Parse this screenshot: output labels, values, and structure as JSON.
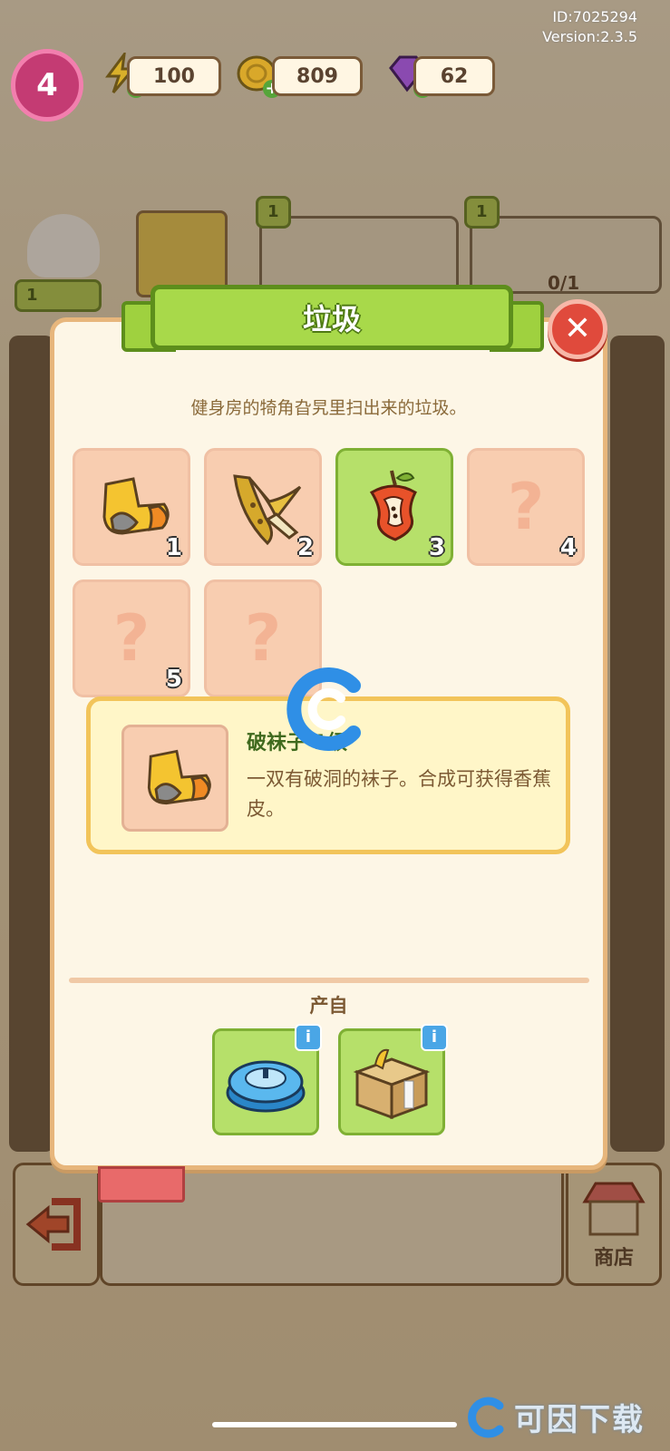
{
  "header": {
    "id_text": "ID:7025294",
    "version_text": "Version:2.3.5",
    "level": "4",
    "resources": [
      {
        "icon": "lightning-icon",
        "value": "100"
      },
      {
        "icon": "coin-icon",
        "value": "809"
      },
      {
        "icon": "gem-icon",
        "value": "62"
      }
    ]
  },
  "background": {
    "cards": [
      {
        "tag": "1"
      },
      {
        "tag": "1"
      },
      {
        "counter": "0/1"
      }
    ],
    "worker_tag": "1",
    "shop_label": "商店"
  },
  "dialog": {
    "title": "垃圾",
    "description": "健身房的犄角旮旯里扫出来的垃圾。",
    "slots": [
      {
        "num": "1",
        "icon": "sock-icon",
        "unlocked": true
      },
      {
        "num": "2",
        "icon": "banana-peel-icon",
        "unlocked": true
      },
      {
        "num": "3",
        "icon": "apple-core-icon",
        "unlocked": true,
        "selected": true
      },
      {
        "num": "4",
        "icon": "question-icon",
        "unlocked": false
      },
      {
        "num": "5",
        "icon": "question-icon",
        "unlocked": false
      },
      {
        "num": "",
        "icon": "question-icon",
        "unlocked": false
      }
    ],
    "info": {
      "title": "破袜子 1级",
      "text": "一双有破洞的袜子。合成可获得香蕉皮。"
    },
    "produce_label": "产自",
    "sources": [
      {
        "icon": "robot-vacuum-icon"
      },
      {
        "icon": "cardboard-box-icon"
      }
    ]
  },
  "watermark": "可因下载",
  "colors": {
    "accent_green": "#a8d94a",
    "close_red": "#e04a3c",
    "slot_peach": "#f8cdb0"
  }
}
